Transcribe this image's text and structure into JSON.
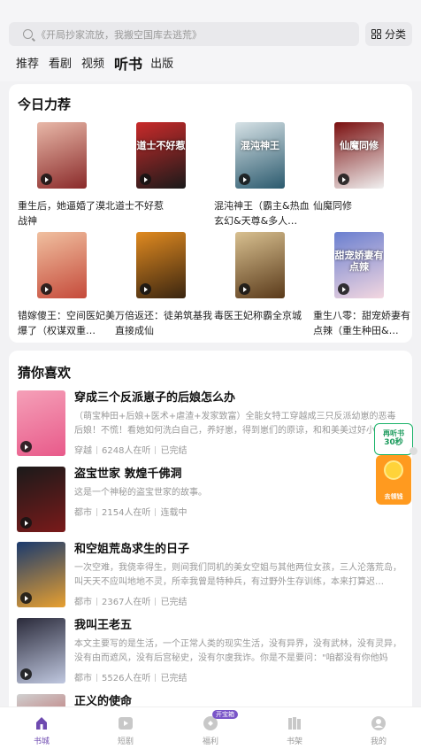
{
  "search": {
    "placeholder": "《开局抄家流放，我搬空国库去逃荒》",
    "category_label": "分类"
  },
  "tabs": [
    {
      "label": "推荐"
    },
    {
      "label": "看剧"
    },
    {
      "label": "视频"
    },
    {
      "label": "听书",
      "active": true
    },
    {
      "label": "出版"
    }
  ],
  "today_picks": {
    "title": "今日力荐",
    "items": [
      {
        "title": "重生后，她逼婚了漠北战神",
        "cover_text": "",
        "colors": [
          "#8a2a2a",
          "#e8b8a8"
        ]
      },
      {
        "title": "道士不好惹",
        "cover_text": "道士不好惹",
        "colors": [
          "#1a1a1a",
          "#c92a2a"
        ]
      },
      {
        "title": "混沌神王（霸主&热血玄幻&天尊&多人…",
        "cover_text": "混沌神王",
        "colors": [
          "#2b5a6e",
          "#d7e2e6"
        ]
      },
      {
        "title": "仙魔同修",
        "cover_text": "仙魔同修",
        "colors": [
          "#f1f1f1",
          "#7a0f0f"
        ]
      },
      {
        "title": "错嫁傻王：空间医妃美爆了（权谋双重…",
        "cover_text": "",
        "colors": [
          "#c54a3a",
          "#f0c0a0"
        ]
      },
      {
        "title": "万倍返还：徒弟筑基我直接成仙",
        "cover_text": "",
        "colors": [
          "#3a2510",
          "#e08a20"
        ]
      },
      {
        "title": "毒医王妃称霸全京城",
        "cover_text": "",
        "colors": [
          "#5a3a1a",
          "#d8c090"
        ]
      },
      {
        "title": "重生八零：甜宠娇妻有点辣（重生种田&…",
        "cover_text": "甜宠娇妻有点辣",
        "colors": [
          "#f3d7e0",
          "#6a7fd0"
        ]
      }
    ]
  },
  "guess": {
    "title": "猜你喜欢",
    "items": [
      {
        "title": "穿成三个反派崽子的后娘怎么办",
        "desc": "（萌宝种田+后娘+医术+虐渣+发家致富）全能女特工穿越成三只反派幼崽的恶毒后娘！不慌！看她如何洗白自己，养好崽，得到崽们的原谅，和和美美过好小日子",
        "genre": "穿越",
        "listeners": "6248人在听",
        "status": "已完结",
        "colors": [
          "#f5a0b8",
          "#e85a8a"
        ]
      },
      {
        "title": "盗宝世家 敦煌千佛洞",
        "desc": "这是一个神秘的盗宝世家的故事。",
        "genre": "都市",
        "listeners": "2154人在听",
        "status": "连载中",
        "colors": [
          "#1a1a1a",
          "#7a1a1a"
        ]
      },
      {
        "title": "和空姐荒岛求生的日子",
        "desc": "一次空难，我侥幸得生，则间我们同机的美女空姐与其他两位女孩，三人沦落荒岛，叫天天不应叫地地不灵，所幸我曾是特种兵，有过野外生存训练，本来打算迟…",
        "genre": "都市",
        "listeners": "2367人在听",
        "status": "已完结",
        "colors": [
          "#1a3a6e",
          "#e8a030"
        ]
      },
      {
        "title": "我叫王老五",
        "desc": "本文主要写的是生活，一个正常人类的现实生活，没有异界，没有武林，没有灵异，没有由而遮风，没有后宫秘史，没有尔虞我诈。你是不是要问：\"咱都没有你他妈还…",
        "genre": "都市",
        "listeners": "5526人在听",
        "status": "已完结",
        "colors": [
          "#2a2a3a",
          "#c0c8e0"
        ]
      },
      {
        "title": "正义的使命",
        "desc": "",
        "genre": "",
        "listeners": "",
        "status": "",
        "colors": [
          "#d0d0d0",
          "#b03030"
        ]
      }
    ]
  },
  "promo": {
    "line1": "再听书",
    "line2": "30秒",
    "line3": "得金币",
    "button": "去领钱"
  },
  "bottom_nav": [
    {
      "label": "书城",
      "active": true,
      "icon": "bookstore-icon"
    },
    {
      "label": "短剧",
      "icon": "play-icon"
    },
    {
      "label": "福利",
      "icon": "gift-icon",
      "badge": "开宝箱"
    },
    {
      "label": "书架",
      "icon": "bookshelf-icon"
    },
    {
      "label": "我的",
      "icon": "profile-icon"
    }
  ],
  "colors": {
    "accent": "#6e4ab0",
    "green": "#1bb36a",
    "orange": "#ff9a1f"
  }
}
